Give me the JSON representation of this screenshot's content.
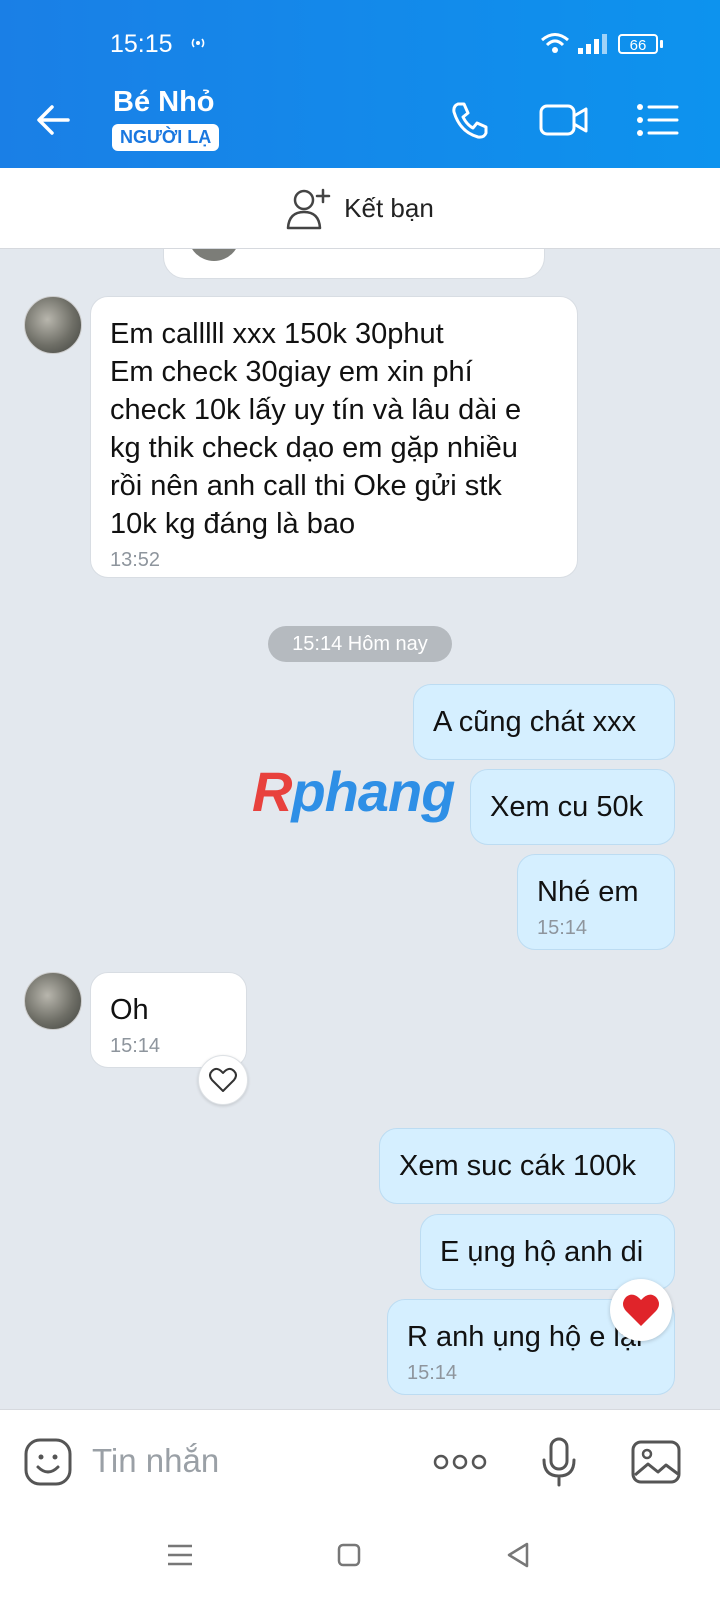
{
  "status_bar": {
    "time": "15:15",
    "battery": "66"
  },
  "header": {
    "contact_name": "Bé Nhỏ",
    "badge": "NGƯỜI LẠ"
  },
  "add_friend": {
    "label": "Kết bạn"
  },
  "messages": [
    {
      "direction": "in",
      "lines": [
        "Em calllll xxx 150k 30phut",
        "Em check 30giay em xin phí",
        "check 10k lấy uy tín và lâu dài e",
        "kg thik check dạo em gặp nhiều",
        "rồi nên anh call thi Oke gửi stk",
        "10k kg đáng là bao"
      ],
      "time": "13:52"
    },
    {
      "direction": "out",
      "text": "A cũng chát xxx"
    },
    {
      "direction": "out",
      "text": "Xem cu 50k"
    },
    {
      "direction": "out",
      "text": "Nhé em",
      "time": "15:14"
    },
    {
      "direction": "in",
      "text": "Oh",
      "time": "15:14"
    },
    {
      "direction": "out",
      "text": "Xem suc cák 100k"
    },
    {
      "direction": "out",
      "text": "E ụng hộ anh di"
    },
    {
      "direction": "out",
      "text": "R anh ụng hộ e lại",
      "time": "15:14"
    }
  ],
  "date_separator": "15:14 Hôm nay",
  "watermark": {
    "first": "R",
    "rest": "phang"
  },
  "input": {
    "placeholder": "Tin nhắn"
  },
  "colors": {
    "header": "#1a7fe6",
    "outgoing_bubble": "#d5efff",
    "incoming_bubble": "#ffffff",
    "chat_background": "#e3e8ee"
  },
  "icons": [
    "arrow-left-icon",
    "phone-icon",
    "video-call-icon",
    "menu-icon",
    "add-friend-icon",
    "heart-outline-icon",
    "heart-filled-icon",
    "emoji-icon",
    "more-icon",
    "microphone-icon",
    "image-icon"
  ]
}
